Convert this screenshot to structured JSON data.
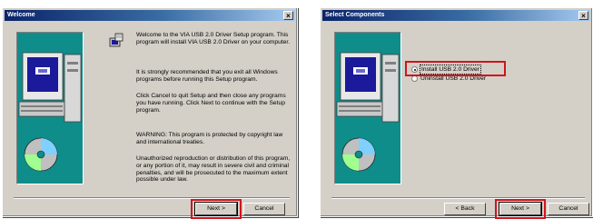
{
  "welcome_dialog": {
    "title": "Welcome",
    "close_glyph": "×",
    "paragraphs": [
      "Welcome to the VIA USB 2.0 Driver Setup program. This program will install VIA USB 2.0 Driver on your computer.",
      "It is strongly recommended that you exit all Windows programs before running this Setup program.",
      "Click Cancel to quit Setup and then close any programs you have running.  Click Next to continue with the Setup program.",
      "WARNING: This program is protected by copyright law and international treaties.",
      "Unauthorized reproduction or distribution of this program, or any portion of it, may result in severe civil and criminal penalties, and will be prosecuted to the maximum extent possible under law."
    ],
    "next_label": "Next >",
    "cancel_label": "Cancel"
  },
  "select_dialog": {
    "title": "Select Components",
    "close_glyph": "×",
    "options": [
      {
        "label": "Install USB 2.0 Driver",
        "selected": true
      },
      {
        "label": "Uninstall USB 2.0 Driver",
        "selected": false
      }
    ],
    "back_label": "< Back",
    "next_label": "Next >",
    "cancel_label": "Cancel"
  },
  "colors": {
    "highlight": "#d0141e",
    "title_gradient_start": "#0a246a",
    "title_gradient_end": "#a6caf0",
    "panel_bg": "#d4d0c8",
    "art_bg": "#0f8d8a"
  },
  "icons": [
    "setup-icon",
    "computer-icon",
    "cd-icon",
    "close-icon",
    "radio-icon"
  ]
}
